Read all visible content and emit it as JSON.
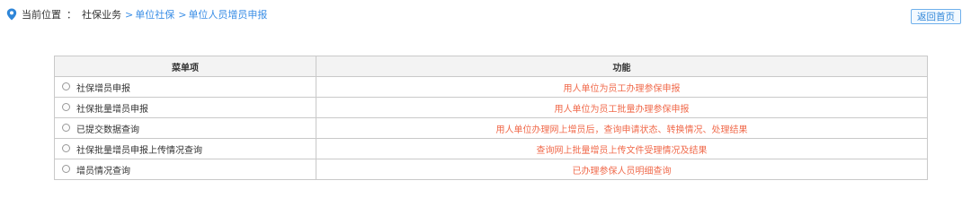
{
  "breadcrumb": {
    "label": "当前位置",
    "separator": "：",
    "current": "社保业务",
    "links": [
      {
        "arrow": ">",
        "label": "单位社保"
      },
      {
        "arrow": ">",
        "label": "单位人员增员申报"
      }
    ]
  },
  "home_button": {
    "label": "返回首页"
  },
  "table": {
    "headers": {
      "item": "菜单项",
      "function": "功能"
    },
    "rows": [
      {
        "item": "社保增员申报",
        "function": "用人单位为员工办理参保申报"
      },
      {
        "item": "社保批量增员申报",
        "function": "用人单位为员工批量办理参保申报"
      },
      {
        "item": "已提交数据查询",
        "function": "用人单位办理网上增员后，查询申请状态、转换情况、处理结果"
      },
      {
        "item": "社保批量增员申报上传情况查询",
        "function": "查询网上批量增员上传文件受理情况及结果"
      },
      {
        "item": "增员情况查询",
        "function": "已办理参保人员明细查询"
      }
    ]
  },
  "colors": {
    "accent": "#3a8ee6",
    "function_text": "#f06a4b",
    "border": "#c9c9c9",
    "header_bg": "#f3f3f3"
  },
  "icons": {
    "location": "location-pin-icon",
    "radio": "radio-icon"
  }
}
